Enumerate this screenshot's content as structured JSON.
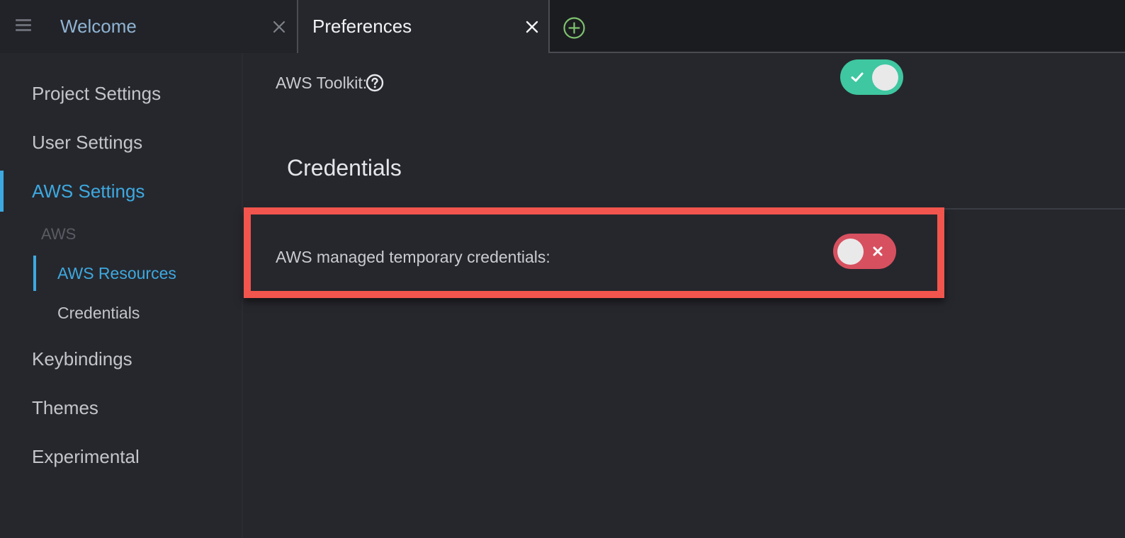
{
  "tabs": [
    {
      "label": "Welcome",
      "active": false
    },
    {
      "label": "Preferences",
      "active": true
    }
  ],
  "sidebar": {
    "items": [
      {
        "label": "Project Settings"
      },
      {
        "label": "User Settings"
      },
      {
        "label": "AWS Settings",
        "active": true
      },
      {
        "label": "Keybindings"
      },
      {
        "label": "Themes"
      },
      {
        "label": "Experimental"
      }
    ],
    "aws_group": {
      "label": "AWS",
      "items": [
        {
          "label": "AWS Resources",
          "active": true
        },
        {
          "label": "Credentials"
        }
      ]
    }
  },
  "main": {
    "aws_toolkit": {
      "label": "AWS Toolkit:",
      "enabled": true
    },
    "credentials_section": {
      "title": "Credentials",
      "managed_temp_credentials": {
        "label": "AWS managed temporary credentials:",
        "enabled": false
      }
    }
  },
  "icons": {
    "menu": "hamburger-icon",
    "close": "close-icon",
    "new_tab": "plus-circle-icon",
    "help": "question-circle-icon",
    "toggle_on": "check-icon",
    "toggle_off": "x-icon"
  },
  "colors": {
    "accent": "#3da9e0",
    "toggle_on": "#3ec7a0",
    "toggle_off": "#d7505f",
    "highlight": "#f2554d",
    "new_tab": "#7ec26e"
  }
}
